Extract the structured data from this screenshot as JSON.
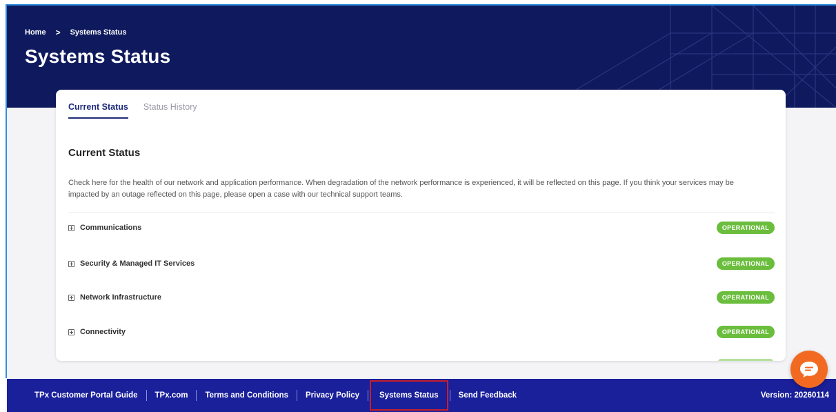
{
  "breadcrumb": {
    "home": "Home",
    "separator": ">",
    "current": "Systems Status"
  },
  "page": {
    "title": "Systems Status"
  },
  "tabs": [
    {
      "label": "Current Status",
      "active": true
    },
    {
      "label": "Status History",
      "active": false
    }
  ],
  "current_status": {
    "title": "Current Status",
    "intro": "Check here for the health of our network and application performance. When degradation of the network performance is experienced, it will be reflected on this page. If you think your services may be impacted by an outage reflected on this page, please open a case with our technical support teams.",
    "items": [
      {
        "label": "Communications",
        "status": "OPERATIONAL"
      },
      {
        "label": "Security & Managed IT Services",
        "status": "OPERATIONAL"
      },
      {
        "label": "Network Infrastructure",
        "status": "OPERATIONAL"
      },
      {
        "label": "Connectivity",
        "status": "OPERATIONAL"
      }
    ]
  },
  "footer": {
    "links": [
      "TPx Customer Portal Guide",
      "TPx.com",
      "Terms and Conditions",
      "Privacy Policy",
      "Systems Status",
      "Send Feedback"
    ],
    "highlighted": "Systems Status",
    "version": "Version: 20260114"
  },
  "colors": {
    "hero_bg": "#0f1a5e",
    "footer_bg": "#1a1f9a",
    "operational_badge": "#6bbd3d",
    "chat_button": "#f26a21",
    "highlight_outline": "#c5202a"
  },
  "icons": {
    "expand": "plus-square-icon",
    "chat": "chat-bubble-icon",
    "breadcrumb_sep": "chevron-right-icon"
  }
}
